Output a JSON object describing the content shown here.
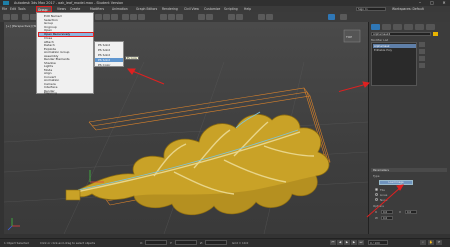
{
  "window": {
    "title": "Autodesk 3ds Max 2017 - oak_leaf_model.max - Student Version",
    "minimize": "–",
    "maximize": "□",
    "close": "✕"
  },
  "menubar": {
    "items": [
      "File",
      "Edit",
      "Tools",
      "Group",
      "Views",
      "Create",
      "Modifiers",
      "Animation",
      "Graph Editors",
      "Rendering",
      "Civil View",
      "Customize",
      "Scripting",
      "Help"
    ],
    "active_index": 3,
    "workspace_label": "Workspaces: Default",
    "search_placeholder": "Sign In"
  },
  "viewport": {
    "label": "[+] [Perspective] [Standard] [Default Shading]"
  },
  "group_menu": {
    "items": [
      "Edit Named",
      "Selection",
      "Group",
      "Ungroup",
      "Open",
      "Open Recursively",
      "Close",
      "Attach",
      "Detach",
      "Explode",
      "Animation Group",
      "Assembly",
      "Render Elements",
      "Shadow",
      "Lights",
      "Mode",
      "Align",
      "Convert",
      "Animation",
      "Camera",
      "Interface",
      "Render",
      "Mapping"
    ],
    "highlighted_index": 5
  },
  "submenu": {
    "items": [
      "PS Solid",
      "PS Solid",
      "PS Solid",
      "PS Solid",
      "PS Color"
    ],
    "highlighted_index": 3,
    "tooltip": "PS Color"
  },
  "right_panel": {
    "object_name": "Alphamask2",
    "list_header": "Modifier List",
    "list_items": [
      "Alphamask",
      "Editable Poly",
      "",
      "",
      ""
    ],
    "selected_index": 0,
    "rollout_title": "Parameters",
    "section_label": "Type",
    "button_label": "Load Image",
    "radio_labels": [
      "Tile",
      "Lines",
      "None"
    ],
    "options_label": "Options",
    "spinner_labels": [
      "U",
      "V",
      "W"
    ],
    "spinner_values": [
      "0.0",
      "0.0",
      "0.0"
    ]
  },
  "status": {
    "object_count": "1 Object Selected",
    "hint": "Click or click-and-drag to select objects",
    "coords_x": "X:",
    "coords_y": "Y:",
    "coords_z": "Z:",
    "grid": "Grid = 10.0",
    "frame": "0 / 100"
  },
  "colors": {
    "leaf": "#c9a227",
    "vein": "#e8d58a",
    "highlight_blue": "#7ec3d8",
    "guide_orange": "#d9822b",
    "accent": "#2f77b6",
    "annotation_red": "#e02020"
  }
}
